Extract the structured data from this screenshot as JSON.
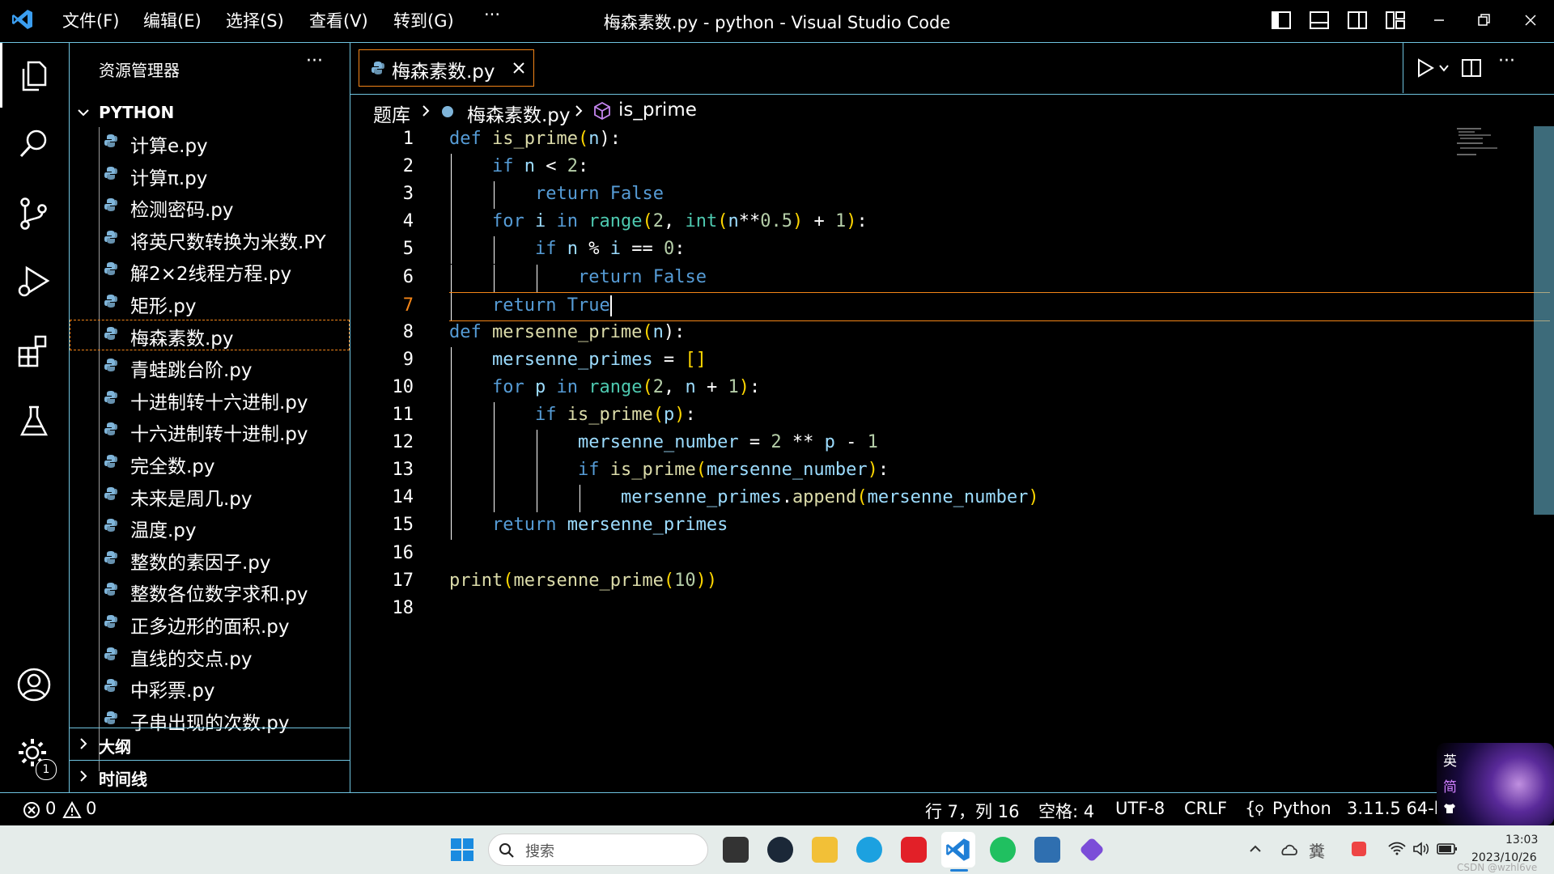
{
  "titlebar": {
    "menu": [
      "文件(F)",
      "编辑(E)",
      "选择(S)",
      "查看(V)",
      "转到(G)",
      "···"
    ],
    "title": "梅森素数.py - python - Visual Studio Code",
    "window_controls": [
      "layout-sidebar-icon",
      "layout-panel-icon",
      "layout-split-icon",
      "layout-custom-icon",
      "minimize-icon",
      "restore-icon",
      "close-icon"
    ]
  },
  "activitybar": {
    "items": [
      "explorer-icon",
      "search-icon",
      "source-control-icon",
      "run-debug-icon",
      "extensions-icon",
      "testing-icon"
    ],
    "bottom": [
      "account-icon",
      "settings-gear-icon"
    ],
    "settings_badge": "1"
  },
  "sidebar": {
    "title": "资源管理器",
    "more": "···",
    "folder": "PYTHON",
    "files": [
      "计算e.py",
      "计算π.py",
      "检测密码.py",
      "将英尺数转换为米数.PY",
      "解2×2线程方程.py",
      "矩形.py",
      "梅森素数.py",
      "青蛙跳台阶.py",
      "十进制转十六进制.py",
      "十六进制转十进制.py",
      "完全数.py",
      "未来是周几.py",
      "温度.py",
      "整数的素因子.py",
      "整数各位数字求和.py",
      "正多边形的面积.py",
      "直线的交点.py",
      "中彩票.py",
      "子串出现的次数.py"
    ],
    "selected_index": 6,
    "sections": [
      "大纲",
      "时间线"
    ]
  },
  "editor": {
    "tab_label": "梅森素数.py",
    "breadcrumb": [
      "题库",
      "梅森素数.py",
      "is_prime"
    ],
    "current_line": 7,
    "lines": [
      {
        "n": "1",
        "indent": 0,
        "tokens": [
          [
            "def ",
            "kw"
          ],
          [
            "is_prime",
            "fn"
          ],
          [
            "(",
            "par"
          ],
          [
            "n",
            "var"
          ],
          [
            "):",
            "op"
          ]
        ]
      },
      {
        "n": "2",
        "indent": 1,
        "tokens": [
          [
            "if ",
            "kw"
          ],
          [
            "n ",
            "var"
          ],
          [
            "< ",
            "op"
          ],
          [
            "2",
            "num"
          ],
          [
            ":",
            "op"
          ]
        ]
      },
      {
        "n": "3",
        "indent": 2,
        "tokens": [
          [
            "return ",
            "kw"
          ],
          [
            "False",
            "kw"
          ]
        ]
      },
      {
        "n": "4",
        "indent": 1,
        "tokens": [
          [
            "for ",
            "kw"
          ],
          [
            "i ",
            "var"
          ],
          [
            "in ",
            "kw"
          ],
          [
            "range",
            "bi"
          ],
          [
            "(",
            "par"
          ],
          [
            "2",
            "num"
          ],
          [
            ", ",
            "op"
          ],
          [
            "int",
            "bi"
          ],
          [
            "(",
            "par"
          ],
          [
            "n",
            "var"
          ],
          [
            "**",
            "op"
          ],
          [
            "0.5",
            "num"
          ],
          [
            ")",
            "par"
          ],
          [
            " + ",
            "op"
          ],
          [
            "1",
            "num"
          ],
          [
            ")",
            "par"
          ],
          [
            ":",
            "op"
          ]
        ]
      },
      {
        "n": "5",
        "indent": 2,
        "tokens": [
          [
            "if ",
            "kw"
          ],
          [
            "n ",
            "var"
          ],
          [
            "% ",
            "op"
          ],
          [
            "i ",
            "var"
          ],
          [
            "== ",
            "op"
          ],
          [
            "0",
            "num"
          ],
          [
            ":",
            "op"
          ]
        ]
      },
      {
        "n": "6",
        "indent": 3,
        "tokens": [
          [
            "return ",
            "kw"
          ],
          [
            "False",
            "kw"
          ]
        ]
      },
      {
        "n": "7",
        "indent": 1,
        "tokens": [
          [
            "return ",
            "kw"
          ],
          [
            "True",
            "kw"
          ]
        ]
      },
      {
        "n": "8",
        "indent": 0,
        "tokens": [
          [
            "def ",
            "kw"
          ],
          [
            "mersenne_prime",
            "fn"
          ],
          [
            "(",
            "par"
          ],
          [
            "n",
            "var"
          ],
          [
            "):",
            "op"
          ]
        ]
      },
      {
        "n": "9",
        "indent": 1,
        "tokens": [
          [
            "mersenne_primes ",
            "var"
          ],
          [
            "= ",
            "op"
          ],
          [
            "[]",
            "par"
          ]
        ]
      },
      {
        "n": "10",
        "indent": 1,
        "tokens": [
          [
            "for ",
            "kw"
          ],
          [
            "p ",
            "var"
          ],
          [
            "in ",
            "kw"
          ],
          [
            "range",
            "bi"
          ],
          [
            "(",
            "par"
          ],
          [
            "2",
            "num"
          ],
          [
            ", ",
            "op"
          ],
          [
            "n ",
            "var"
          ],
          [
            "+ ",
            "op"
          ],
          [
            "1",
            "num"
          ],
          [
            ")",
            "par"
          ],
          [
            ":",
            "op"
          ]
        ]
      },
      {
        "n": "11",
        "indent": 2,
        "tokens": [
          [
            "if ",
            "kw"
          ],
          [
            "is_prime",
            "fn"
          ],
          [
            "(",
            "par"
          ],
          [
            "p",
            "var"
          ],
          [
            ")",
            "par"
          ],
          [
            ":",
            "op"
          ]
        ]
      },
      {
        "n": "12",
        "indent": 3,
        "tokens": [
          [
            "mersenne_number ",
            "var"
          ],
          [
            "= ",
            "op"
          ],
          [
            "2 ",
            "num"
          ],
          [
            "** ",
            "op"
          ],
          [
            "p ",
            "var"
          ],
          [
            "- ",
            "op"
          ],
          [
            "1",
            "num"
          ]
        ]
      },
      {
        "n": "13",
        "indent": 3,
        "tokens": [
          [
            "if ",
            "kw"
          ],
          [
            "is_prime",
            "fn"
          ],
          [
            "(",
            "par"
          ],
          [
            "mersenne_number",
            "var"
          ],
          [
            ")",
            "par"
          ],
          [
            ":",
            "op"
          ]
        ]
      },
      {
        "n": "14",
        "indent": 4,
        "tokens": [
          [
            "mersenne_primes",
            "var"
          ],
          [
            ".",
            "op"
          ],
          [
            "append",
            "fn"
          ],
          [
            "(",
            "par"
          ],
          [
            "mersenne_number",
            "var"
          ],
          [
            ")",
            "par"
          ]
        ]
      },
      {
        "n": "15",
        "indent": 1,
        "tokens": [
          [
            "return ",
            "kw"
          ],
          [
            "mersenne_primes",
            "var"
          ]
        ]
      },
      {
        "n": "16",
        "indent": 0,
        "tokens": []
      },
      {
        "n": "17",
        "indent": 0,
        "tokens": [
          [
            "print",
            "fn"
          ],
          [
            "(",
            "par"
          ],
          [
            "mersenne_prime",
            "fn"
          ],
          [
            "(",
            "par"
          ],
          [
            "10",
            "num"
          ],
          [
            "))",
            "par"
          ]
        ]
      },
      {
        "n": "18",
        "indent": 0,
        "tokens": []
      }
    ]
  },
  "statusbar": {
    "errors": "0",
    "warnings": "0",
    "position": "行 7，列 16",
    "spaces": "空格: 4",
    "encoding": "UTF-8",
    "eol": "CRLF",
    "language": "Python",
    "interpreter": "3.11.5 64-bi"
  },
  "ime": {
    "lang": "英",
    "mode": "简"
  },
  "taskbar": {
    "search_placeholder": "搜索",
    "apps": [
      "start-icon",
      "task-view-icon",
      "steam-icon",
      "file-explorer-icon",
      "edge-icon",
      "netease-music-icon",
      "vscode-icon",
      "wechat-icon",
      "app-window-icon",
      "obsidian-icon"
    ],
    "time": "13:03",
    "date": "2023/10/26",
    "watermark": "CSDN @wzhl6ve"
  },
  "colors": {
    "contrast_border": "#6fc3df",
    "focus_border": "#f38518",
    "keyword": "#569cd6",
    "function": "#dcdcaa",
    "builtin": "#4ec9b0",
    "number": "#b5cea8",
    "variable": "#9cdcfe",
    "bracket": "#ffd700"
  }
}
